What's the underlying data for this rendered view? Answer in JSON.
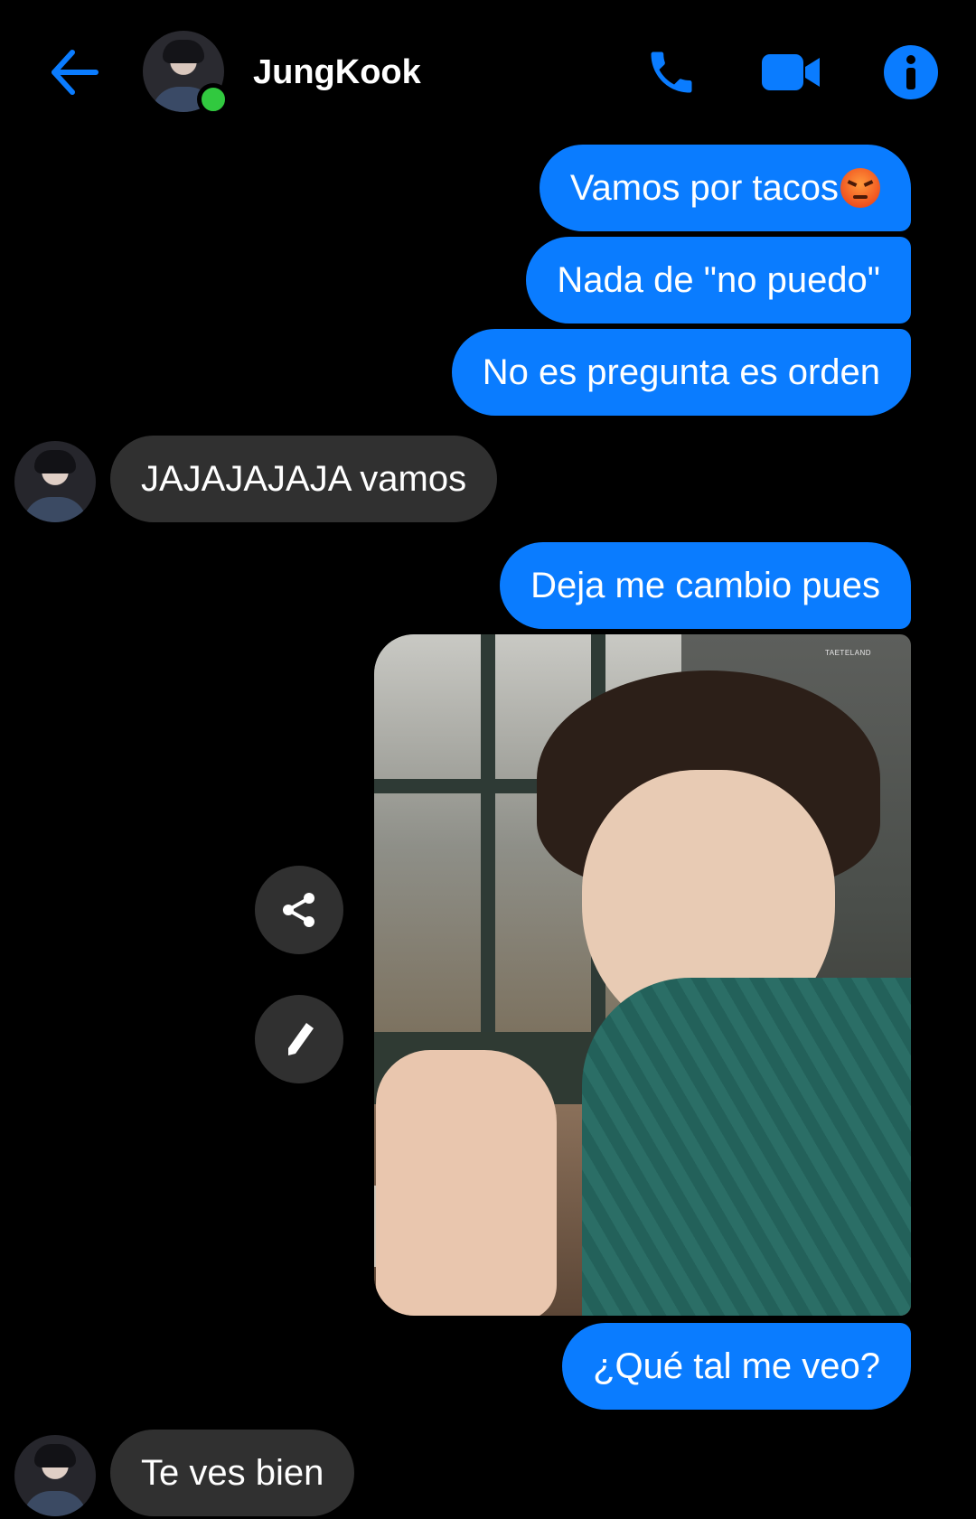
{
  "header": {
    "contact_name": "JungKook",
    "online": true,
    "accent_color": "#0a7cff",
    "online_color": "#31c93f",
    "icons": [
      "arrow-left-icon",
      "phone-icon",
      "video-camera-icon",
      "info-icon"
    ]
  },
  "messages": [
    {
      "from": "me",
      "text": "Vamos por tacos",
      "emoji": "angry-face"
    },
    {
      "from": "me",
      "text": "Nada de \"no puedo\""
    },
    {
      "from": "me",
      "text": "No es pregunta es orden"
    },
    {
      "from": "contact",
      "text": "JAJAJAJAJA vamos"
    },
    {
      "from": "me",
      "text": "Deja me cambio pues"
    },
    {
      "from": "me",
      "type": "photo",
      "watermark": "TAETELAND"
    },
    {
      "from": "me",
      "text": "¿Qué tal me veo?"
    },
    {
      "from": "contact",
      "text": "Te ves bien"
    }
  ],
  "photo_actions": {
    "icons": [
      "share-icon",
      "pencil-icon"
    ]
  },
  "colors": {
    "sent_bubble": "#0a7cff",
    "received_bubble": "#303030",
    "background": "#000000"
  }
}
